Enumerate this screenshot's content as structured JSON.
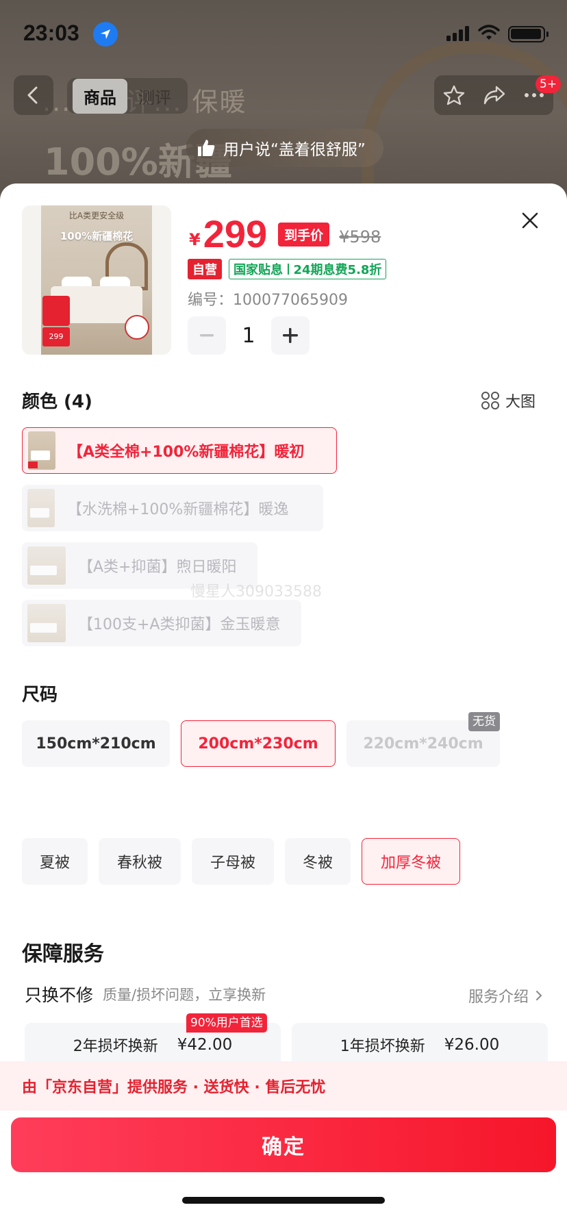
{
  "status": {
    "time": "23:03"
  },
  "nav": {
    "tabs": [
      "商品",
      "测评"
    ],
    "badge": "5+",
    "review_text": "用户说“盖着很舒服”",
    "ghost_text": "...瞳测评... 保暖",
    "ghost_big": "100%新疆"
  },
  "product": {
    "thumb_head": "比A类更安全级",
    "thumb_title": "100%新疆棉花",
    "thumb_price": "299",
    "currency": "¥",
    "price": "299",
    "price_tag": "到手价",
    "orig_price": "¥598",
    "tag_self": "自营",
    "tag_subsidy_a": "国家贴息",
    "tag_subsidy_b": "24期息费5.8折",
    "sku_line": "编号：100077065909",
    "qty": "1"
  },
  "color": {
    "title": "颜色 (4)",
    "bigimg": "大图",
    "options": [
      "【A类全棉+100%新疆棉花】暖初",
      "【水洗棉+100%新疆棉花】暖逸",
      "【A类+抑菌】煦日暖阳",
      "【100支+A类抑菌】金玉暖意"
    ],
    "selected_index": 0
  },
  "watermark": "慢星人309033588",
  "size": {
    "title": "尺码",
    "options": [
      "150cm*210cm",
      "200cm*230cm",
      "220cm*240cm"
    ],
    "selected_index": 1,
    "out_of_stock_label": "无货"
  },
  "type": {
    "options": [
      "夏被",
      "春秋被",
      "子母被",
      "冬被",
      "加厚冬被"
    ],
    "selected_index": 4
  },
  "service": {
    "title": "保障服务",
    "name": "只换不修",
    "desc": "质量/损坏问题，立享换新",
    "intro": "服务介绍",
    "badge": "90%用户首选",
    "cards": [
      {
        "label": "2年损坏换新",
        "price": "¥42.00"
      },
      {
        "label": "1年损坏换新",
        "price": "¥26.00"
      }
    ]
  },
  "promise": "由「京东自营」提供服务 · 送货快 · 售后无忧",
  "confirm_label": "确定",
  "colors": {
    "accent": "#f2243a",
    "green": "#12a556"
  },
  "icons": [
    "location-arrow-icon",
    "signal-icon",
    "wifi-icon",
    "battery-icon",
    "back-chevron-icon",
    "star-icon",
    "share-icon",
    "more-icon",
    "thumbs-up-icon",
    "close-icon",
    "minus-icon",
    "plus-icon",
    "grid-icon",
    "chevron-right-icon"
  ]
}
